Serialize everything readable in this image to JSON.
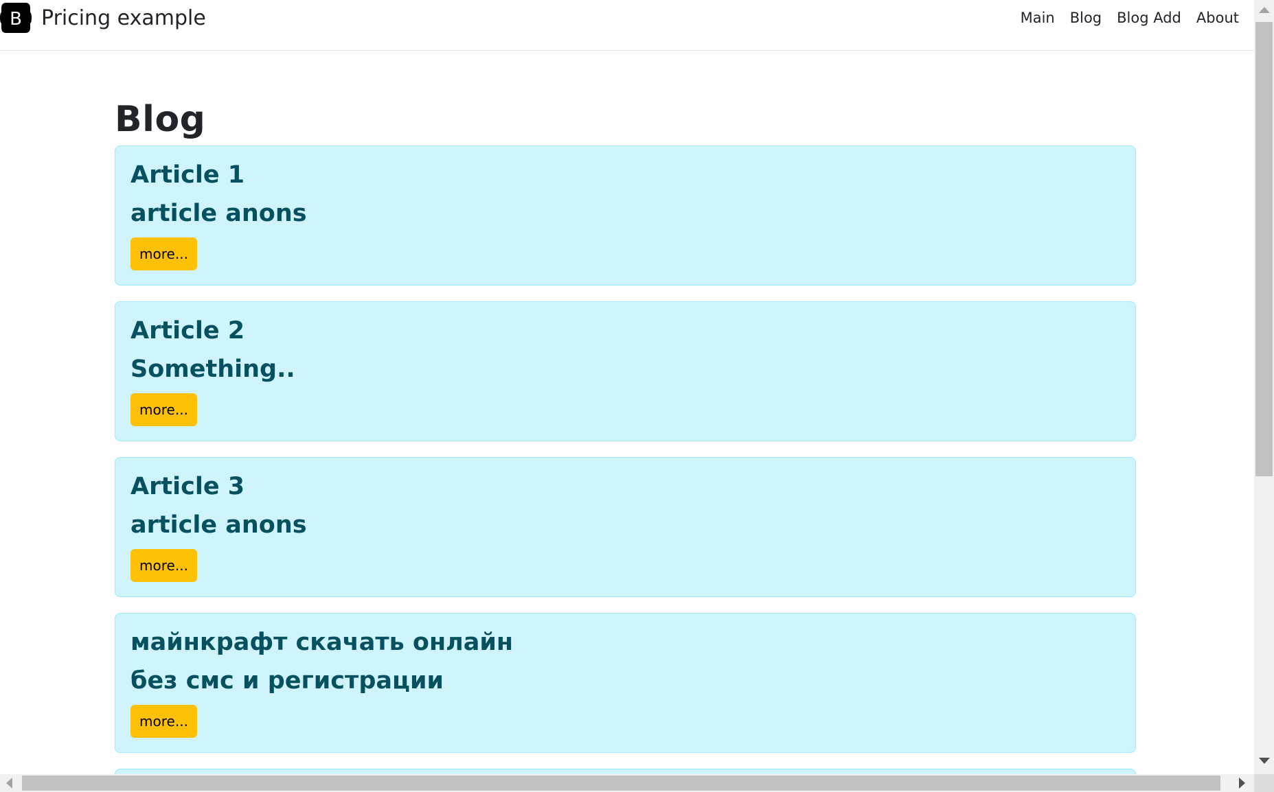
{
  "header": {
    "brand_icon": "bootstrap-logo-icon",
    "brand_text": "Pricing example",
    "nav": [
      {
        "label": "Main"
      },
      {
        "label": "Blog"
      },
      {
        "label": "Blog Add"
      },
      {
        "label": "About"
      }
    ]
  },
  "main": {
    "title": "Blog",
    "articles": [
      {
        "title": "Article 1",
        "anons": "article anons",
        "button": "more..."
      },
      {
        "title": "Article 2",
        "anons": "Something..",
        "button": "more..."
      },
      {
        "title": "Article 3",
        "anons": "article anons",
        "button": "more..."
      },
      {
        "title": "майнкрафт скачать онлайн",
        "anons": "без смс и регистрации",
        "button": "more..."
      }
    ]
  },
  "colors": {
    "card_bg": "#cff4fc",
    "card_border": "#9eeaf9",
    "card_text": "#055160",
    "button_bg": "#ffc107"
  }
}
